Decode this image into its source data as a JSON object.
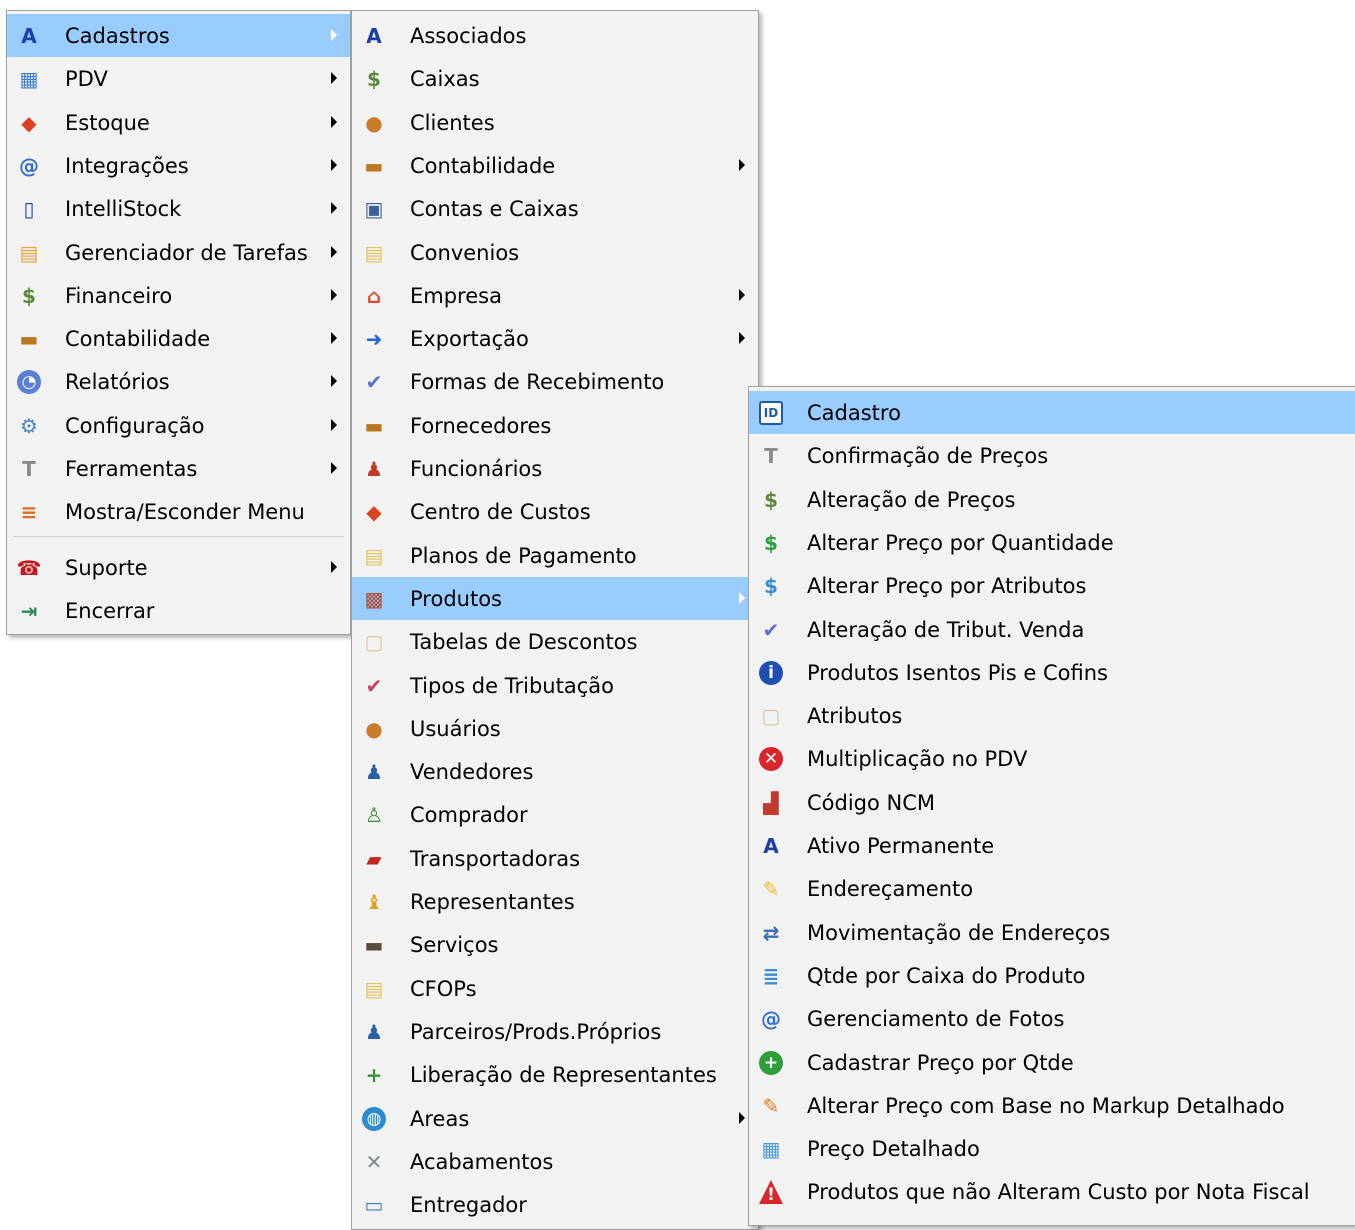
{
  "menu_main": {
    "items": [
      {
        "label": "Cadastros",
        "icon": "user-blue-icon",
        "glyph": "A",
        "bg": "#1c3fa8",
        "has_submenu": true,
        "highlighted": true
      },
      {
        "label": "PDV",
        "icon": "cash-register-icon",
        "glyph": "▦",
        "bg": "#3d7cd6",
        "has_submenu": true
      },
      {
        "label": "Estoque",
        "icon": "stock-boxes-icon",
        "glyph": "◆",
        "bg": "#d9431e",
        "has_submenu": true
      },
      {
        "label": "Integrações",
        "icon": "at-sign-icon",
        "glyph": "@",
        "bg": "#2f6fd0",
        "has_submenu": true
      },
      {
        "label": "IntelliStock",
        "icon": "mobile-device-icon",
        "glyph": "▯",
        "bg": "#1a4c9e",
        "has_submenu": true
      },
      {
        "label": "Gerenciador de Tarefas",
        "icon": "clipboard-icon",
        "glyph": "▤",
        "bg": "#e9a23b",
        "has_submenu": true
      },
      {
        "label": "Financeiro",
        "icon": "money-bag-icon",
        "glyph": "$",
        "bg": "#5b8a3c",
        "has_submenu": true
      },
      {
        "label": "Contabilidade",
        "icon": "briefcase-icon",
        "glyph": "▬",
        "bg": "#b9771f",
        "has_submenu": true
      },
      {
        "label": "Relatórios",
        "icon": "pie-chart-icon",
        "glyph": "◔",
        "bg": "#5a7fd6",
        "has_submenu": true
      },
      {
        "label": "Configuração",
        "icon": "settings-computer-icon",
        "glyph": "⚙",
        "bg": "#4a86c6",
        "has_submenu": true
      },
      {
        "label": "Ferramentas",
        "icon": "hammer-icon",
        "glyph": "T",
        "bg": "#8a8a8a",
        "has_submenu": true
      },
      {
        "label": "Mostra/Esconder Menu",
        "icon": "toggle-menu-icon",
        "glyph": "≡",
        "bg": "#e06a1c",
        "has_submenu": false
      },
      {
        "label": "Suporte",
        "icon": "telephone-icon",
        "glyph": "☎",
        "bg": "#c4181c",
        "has_submenu": true
      },
      {
        "label": "Encerrar",
        "icon": "exit-door-icon",
        "glyph": "⇥",
        "bg": "#2b8c56",
        "has_submenu": false
      }
    ]
  },
  "menu_cadastros": {
    "items": [
      {
        "label": "Associados",
        "icon": "user-blue-icon",
        "glyph": "A",
        "bg": "#1c3fa8",
        "has_submenu": false
      },
      {
        "label": "Caixas",
        "icon": "money-bag-icon",
        "glyph": "$",
        "bg": "#5b8a3c",
        "has_submenu": false
      },
      {
        "label": "Clientes",
        "icon": "users-icon",
        "glyph": "●",
        "bg": "#c97a2a",
        "has_submenu": false
      },
      {
        "label": "Contabilidade",
        "icon": "briefcase-icon",
        "glyph": "▬",
        "bg": "#b9771f",
        "has_submenu": true
      },
      {
        "label": "Contas e Caixas",
        "icon": "accounts-icon",
        "glyph": "▣",
        "bg": "#3b5fa0",
        "has_submenu": false
      },
      {
        "label": "Convenios",
        "icon": "notepad-icon",
        "glyph": "▤",
        "bg": "#e4c25b",
        "has_submenu": false
      },
      {
        "label": "Empresa",
        "icon": "house-icon",
        "glyph": "⌂",
        "bg": "#d84f2e",
        "has_submenu": true
      },
      {
        "label": "Exportação",
        "icon": "arrow-right-icon",
        "glyph": "➜",
        "bg": "#1f66d6",
        "has_submenu": true
      },
      {
        "label": "Formas de Recebimento",
        "icon": "check-payment-icon",
        "glyph": "✔",
        "bg": "#5b6fcc",
        "has_submenu": false
      },
      {
        "label": "Fornecedores",
        "icon": "briefcase-icon",
        "glyph": "▬",
        "bg": "#b9771f",
        "has_submenu": false
      },
      {
        "label": "Funcionários",
        "icon": "workers-icon",
        "glyph": "♟",
        "bg": "#c03a2a",
        "has_submenu": false
      },
      {
        "label": "Centro de Custos",
        "icon": "stock-boxes-icon",
        "glyph": "◆",
        "bg": "#d9431e",
        "has_submenu": false
      },
      {
        "label": "Planos de Pagamento",
        "icon": "notepad-icon",
        "glyph": "▤",
        "bg": "#e4c25b",
        "has_submenu": false
      },
      {
        "label": "Produtos",
        "icon": "product-box-icon",
        "glyph": "▩",
        "bg": "#b24a2e",
        "has_submenu": true,
        "highlighted": true
      },
      {
        "label": "Tabelas de Descontos",
        "icon": "document-icon",
        "glyph": "▢",
        "bg": "#d8c69a",
        "has_submenu": false
      },
      {
        "label": "Tipos de Tributação",
        "icon": "tax-check-icon",
        "glyph": "✔",
        "bg": "#c9405a",
        "has_submenu": false
      },
      {
        "label": "Usuários",
        "icon": "users-icon",
        "glyph": "●",
        "bg": "#c97a2a",
        "has_submenu": false
      },
      {
        "label": "Vendedores",
        "icon": "salesman-icon",
        "glyph": "♟",
        "bg": "#2a5fa8",
        "has_submenu": false
      },
      {
        "label": "Comprador",
        "icon": "buyer-icon",
        "glyph": "♙",
        "bg": "#3f8f3a",
        "has_submenu": false
      },
      {
        "label": "Transportadoras",
        "icon": "truck-icon",
        "glyph": "▰",
        "bg": "#c4281c",
        "has_submenu": false
      },
      {
        "label": "Representantes",
        "icon": "representative-icon",
        "glyph": "♝",
        "bg": "#d9a21a",
        "has_submenu": false
      },
      {
        "label": "Serviços",
        "icon": "toolbox-icon",
        "glyph": "▬",
        "bg": "#5a4a3a",
        "has_submenu": false
      },
      {
        "label": "CFOPs",
        "icon": "notepad-icon",
        "glyph": "▤",
        "bg": "#e4c25b",
        "has_submenu": false
      },
      {
        "label": "Parceiros/Prods.Próprios",
        "icon": "salesman-icon",
        "glyph": "♟",
        "bg": "#2a5fa8",
        "has_submenu": false
      },
      {
        "label": "Liberação de Representantes",
        "icon": "user-add-icon",
        "glyph": "+",
        "bg": "#3f8f3a",
        "has_submenu": false
      },
      {
        "label": "Areas",
        "icon": "globe-icon",
        "glyph": "◍",
        "bg": "#2e8ad0",
        "has_submenu": true
      },
      {
        "label": "Acabamentos",
        "icon": "tools-icon",
        "glyph": "✕",
        "bg": "#7a8a9a",
        "has_submenu": false
      },
      {
        "label": "Entregador",
        "icon": "delivery-icon",
        "glyph": "▭",
        "bg": "#3a7ec8",
        "has_submenu": false
      }
    ]
  },
  "menu_produtos": {
    "items": [
      {
        "label": "Cadastro",
        "icon": "id-card-icon",
        "glyph": "ID",
        "bg": "#1f5aa6",
        "has_submenu": false,
        "highlighted": true
      },
      {
        "label": "Confirmação de Preços",
        "icon": "hammer-icon",
        "glyph": "T",
        "bg": "#8a8a8a",
        "has_submenu": false
      },
      {
        "label": "Alteração de Preços",
        "icon": "money-bag-icon",
        "glyph": "$",
        "bg": "#5b8a3c",
        "has_submenu": false
      },
      {
        "label": "Alterar Preço por Quantidade",
        "icon": "dollar-icon",
        "glyph": "$",
        "bg": "#2f9e3a",
        "has_submenu": false
      },
      {
        "label": "Alterar Preço por Atributos",
        "icon": "price-list-icon",
        "glyph": "$",
        "bg": "#3a8ed0",
        "has_submenu": false
      },
      {
        "label": "Alteração de Tribut. Venda",
        "icon": "check-payment-icon",
        "glyph": "✔",
        "bg": "#5b6fcc",
        "has_submenu": false
      },
      {
        "label": "Produtos Isentos Pis e Cofins",
        "icon": "info-icon",
        "glyph": "i",
        "bg": "#1f4fb0",
        "has_submenu": false
      },
      {
        "label": "Atributos",
        "icon": "document-icon",
        "glyph": "▢",
        "bg": "#d8c69a",
        "has_submenu": false
      },
      {
        "label": "Multiplicação no PDV",
        "icon": "error-x-icon",
        "glyph": "✕",
        "bg": "#d8262a",
        "has_submenu": false
      },
      {
        "label": "Código NCM",
        "icon": "code-board-icon",
        "glyph": "▟",
        "bg": "#c23a2e",
        "has_submenu": false
      },
      {
        "label": "Ativo Permanente",
        "icon": "user-blue-icon",
        "glyph": "A",
        "bg": "#1c3fa8",
        "has_submenu": false
      },
      {
        "label": "Endereçamento",
        "icon": "pencil-tag-icon",
        "glyph": "✎",
        "bg": "#f0c02a",
        "has_submenu": false
      },
      {
        "label": "Movimentação de Endereços",
        "icon": "move-icon",
        "glyph": "⇄",
        "bg": "#3a6fb0",
        "has_submenu": false
      },
      {
        "label": "Qtde por Caixa do Produto",
        "icon": "database-icon",
        "glyph": "≣",
        "bg": "#3a8ed0",
        "has_submenu": false
      },
      {
        "label": "Gerenciamento de Fotos",
        "icon": "at-sign-icon",
        "glyph": "@",
        "bg": "#2f6fd0",
        "has_submenu": false
      },
      {
        "label": "Cadastrar Preço por Qtde",
        "icon": "plus-circle-icon",
        "glyph": "+",
        "bg": "#2f9e3a",
        "has_submenu": false
      },
      {
        "label": "Alterar Preço com Base no Markup Detalhado",
        "icon": "pencil-icon",
        "glyph": "✎",
        "bg": "#e87a1c",
        "has_submenu": false
      },
      {
        "label": "Preço Detalhado",
        "icon": "table-icon",
        "glyph": "▦",
        "bg": "#4f9bd6",
        "has_submenu": false
      },
      {
        "label": "Produtos que não Alteram Custo por Nota Fiscal",
        "icon": "warning-icon",
        "glyph": "!",
        "bg": "#d8262a",
        "has_submenu": false
      }
    ]
  }
}
